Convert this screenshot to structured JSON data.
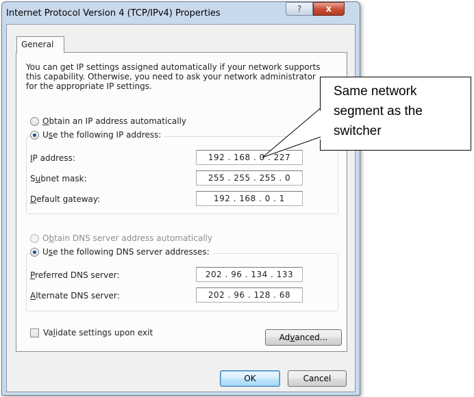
{
  "window": {
    "title": "Internet Protocol Version 4 (TCP/IPv4) Properties",
    "help_glyph": "?",
    "close_glyph": "x"
  },
  "tabs": [
    {
      "label": "General",
      "active": true
    }
  ],
  "intro": {
    "line1": "You can get IP settings assigned automatically if your network supports",
    "line2": "this capability. Otherwise, you need to ask your network administrator",
    "line3": "for the appropriate IP settings."
  },
  "ip_section": {
    "auto_radio": {
      "pre": "",
      "key": "O",
      "post": "btain an IP address automatically",
      "checked": false
    },
    "manual_radio": {
      "pre": "U",
      "key": "s",
      "post": "e the following IP address:",
      "checked": true
    },
    "fields": {
      "ip": {
        "key": "I",
        "rest": "P address:",
        "value": "192 . 168 .  0  . 227"
      },
      "subnet": {
        "pre": "S",
        "key": "u",
        "post": "bnet mask:",
        "value": "255 . 255 . 255 .  0"
      },
      "gateway": {
        "key": "D",
        "rest": "efault gateway:",
        "value": "192 . 168 .  0  .  1"
      }
    }
  },
  "dns_section": {
    "auto_radio": {
      "pre": "O",
      "key": "b",
      "post": "tain DNS server address automatically",
      "checked": false,
      "disabled": true
    },
    "manual_radio": {
      "pre": "U",
      "key": "s",
      "post": "e the following DNS server addresses:",
      "checked": true
    },
    "fields": {
      "preferred": {
        "key": "P",
        "rest": "referred DNS server:",
        "value": "202 .  96  . 134 . 133"
      },
      "alternate": {
        "key": "A",
        "rest": "lternate DNS server:",
        "value": "202 .  96  . 128 .  68"
      }
    }
  },
  "validate": {
    "pre": "Va",
    "key": "l",
    "post": "idate settings upon exit",
    "checked": false
  },
  "buttons": {
    "advanced": {
      "pre": "Ad",
      "key": "v",
      "post": "anced..."
    },
    "ok": "OK",
    "cancel": "Cancel"
  },
  "callout": {
    "line1": "Same network",
    "line2": "segment as the",
    "line3": "switcher"
  },
  "colors": {
    "window_frame": "#c9d9ec",
    "dialog_bg": "#f0f0f0",
    "close_button": "#c84c33",
    "default_button_border": "#3c7fb1"
  }
}
